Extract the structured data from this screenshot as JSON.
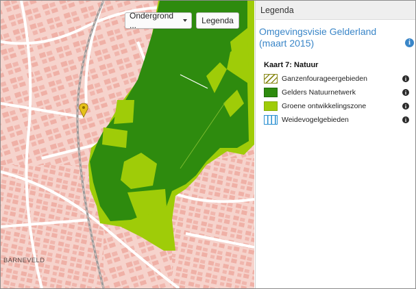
{
  "map": {
    "basemap_button_label": "Ondergrond ...",
    "legend_button_label": "Legenda",
    "place_label": "BARNEVELD",
    "colors": {
      "urban": "#f6d3cc",
      "building": "#efb0a6",
      "natuurnetwerk": "#2e8b0e",
      "ontwikkelingszone": "#9fcc08",
      "rail": "#9a9a9a"
    }
  },
  "panel": {
    "header": "Legenda",
    "title": "Omgevingsvisie Gelderland (maart 2015)",
    "section_title": "Kaart 7: Natuur",
    "items": [
      {
        "label": "Ganzenfourageergebieden",
        "icon": "hatched-swatch"
      },
      {
        "label": "Gelders Natuurnetwerk",
        "icon": "dark-green-swatch"
      },
      {
        "label": "Groene ontwikkelingszone",
        "icon": "light-green-swatch"
      },
      {
        "label": "Weidevogelgebieden",
        "icon": "blue-striped-swatch"
      }
    ]
  }
}
